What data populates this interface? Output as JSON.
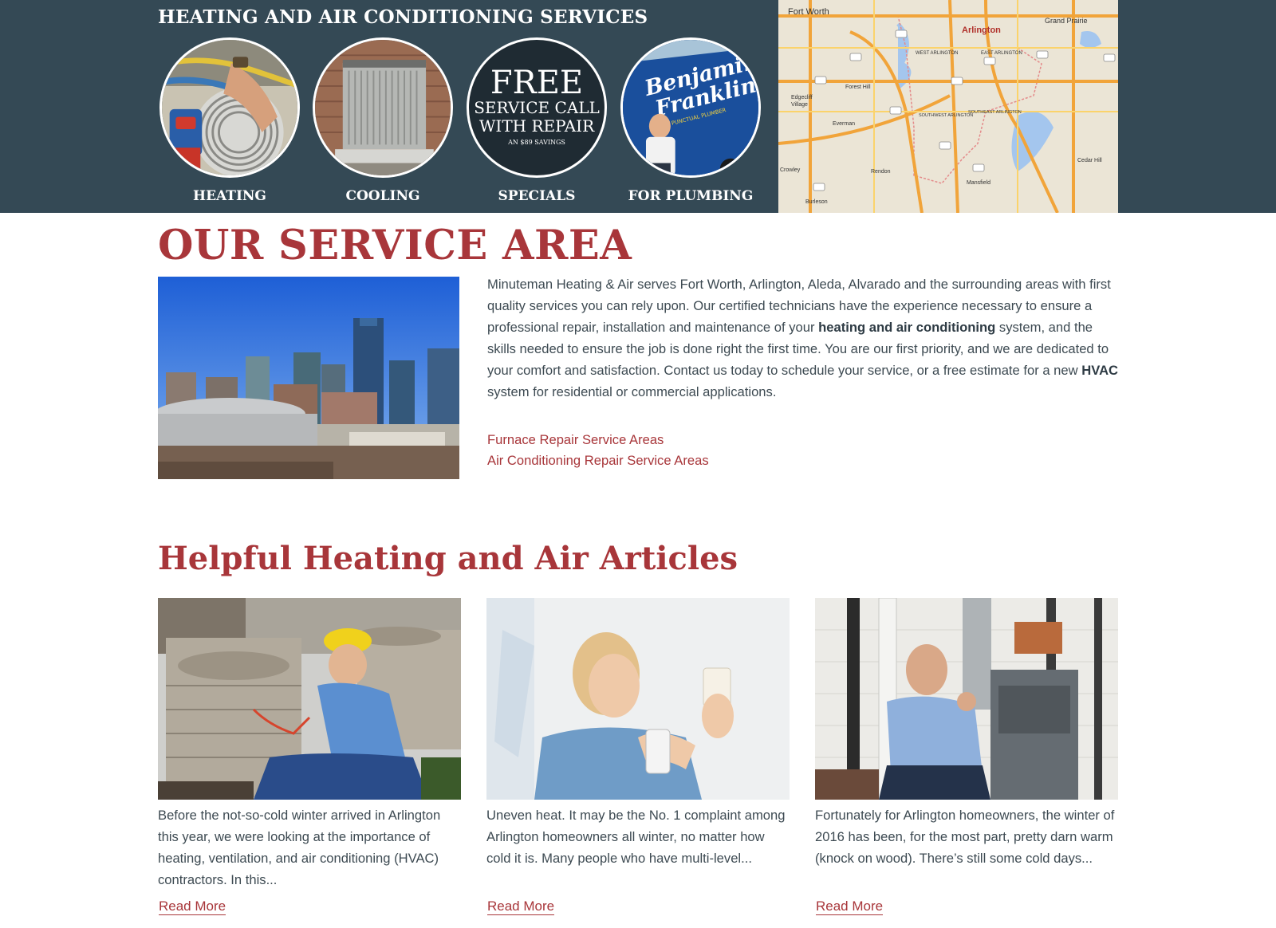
{
  "services": {
    "title": "HEATING AND AIR CONDITIONING SERVICES",
    "items": [
      {
        "label": "HEATING"
      },
      {
        "label": "COOLING"
      },
      {
        "label": "SPECIALS"
      },
      {
        "label": "FOR PLUMBING"
      }
    ],
    "specials_badge": {
      "line1": "FREE",
      "line2": "SERVICE CALL",
      "line3": "WITH REPAIR",
      "line4": "AN $89 SAVINGS"
    },
    "plumbing_logo": {
      "line1": "Benjamin",
      "line2": "Franklin",
      "line3": "PUNCTUAL PLUMBER"
    }
  },
  "map": {
    "labels": [
      "Fort Worth",
      "Grand Prairie",
      "Arlington",
      "WEST ARLINGTON",
      "EAST ARLINGTON",
      "Forest Hill",
      "Edgecliff Village",
      "SOUTHWEST ARLINGTON",
      "SOUTHEAST ARLINGTON",
      "Everman",
      "Rendon",
      "Mansfield",
      "Cedar Hill",
      "Crowley",
      "Burleson"
    ],
    "route_shields": [
      "180",
      "287",
      "20",
      "360",
      "287",
      "303",
      "408",
      "35W",
      "287",
      "287",
      "20",
      "360",
      "35W"
    ]
  },
  "service_area": {
    "title": "OUR SERVICE AREA",
    "text_1": "Minuteman Heating & Air serves Fort Worth, Arlington, Aleda, Alvarado and the surrounding areas with first quality services you can rely upon. Our certified technicians have the experience necessary to ensure a professional repair, installation and maintenance of your ",
    "bold_1": "heating and air conditioning",
    "text_2": " system, and the skills needed to ensure the job is done right the first time. You are our first priority, and we are dedicated to your comfort and satisfaction. Contact us today to schedule your service, or a free estimate for a new ",
    "bold_2": "HVAC",
    "text_3": " system for residential or commercial applications.",
    "links": [
      "Furnace Repair Service Areas",
      "Air Conditioning Repair Service Areas"
    ]
  },
  "articles": {
    "title": "Helpful Heating and Air Articles",
    "items": [
      {
        "excerpt": "Before the not-so-cold winter arrived in Arlington this year, we were looking at the importance of heating, ventilation, and air conditioning (HVAC) contractors. In this...",
        "link": "Read More"
      },
      {
        "excerpt": "Uneven heat. It may be the No. 1 complaint among Arlington homeowners all winter, no matter how cold it is. Many people who have multi-level...",
        "link": "Read More"
      },
      {
        "excerpt": "Fortunately for Arlington homeowners, the winter of 2016 has been, for the most part, pretty darn warm (knock on wood). There’s still some cold days...",
        "link": "Read More"
      }
    ]
  },
  "colors": {
    "band": "#344955",
    "accent": "#a8363a",
    "text": "#3d4a52",
    "white": "#ffffff"
  }
}
